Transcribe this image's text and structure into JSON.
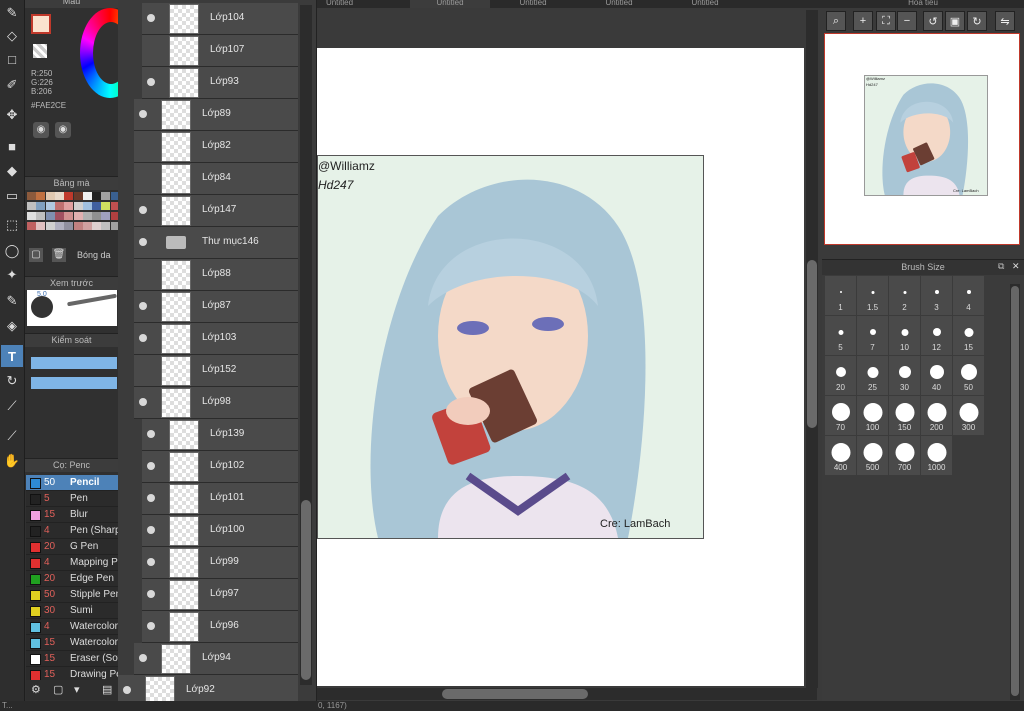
{
  "tabs": [
    "Untitled",
    "Untitled",
    "Untitled",
    "Untitled",
    "Untitled"
  ],
  "color_panel": {
    "title": "Màu",
    "rgb": [
      "R:250",
      "G:226",
      "B:206"
    ],
    "hex": "#FAE2CE",
    "current_color": "#FAE2CE"
  },
  "palette": {
    "title": "Bảng mà",
    "colors": [
      "#8c5a3c",
      "#c07040",
      "#e0c8b0",
      "#e8d8c8",
      "#c0392b",
      "#6b3a2a",
      "#f0f0f0",
      "#202020",
      "#a0a0a0",
      "#3a6090",
      "#c0c0c0",
      "#80a0c0",
      "#b0c8e0",
      "#c07070",
      "#e0a0a0",
      "#d0d0d0",
      "#a0c0e0",
      "#4060a0",
      "#d0e060",
      "#c05050",
      "#e0e0e0",
      "#c0c0c0",
      "#8090b0",
      "#a05060",
      "#d09090",
      "#e0b0b0",
      "#b0b0b0",
      "#909090",
      "#a0a0c0",
      "#b04040",
      "#c06060",
      "#e0c0c0",
      "#d0d0d0",
      "#b0b0c0",
      "#9090a0",
      "#c08080",
      "#d0a0a0",
      "#e0d0d0",
      "#c0c0c0",
      "#a0a0a0"
    ],
    "shadow_label": "Bóng da"
  },
  "preview": {
    "title": "Xem trước",
    "size_label": "5.0"
  },
  "control": {
    "title": "Kiểm soát"
  },
  "brushes": {
    "title": "Cọ: Penc",
    "items": [
      {
        "size": "50",
        "name": "Pencil",
        "color": "#2e8bd6",
        "selected": true
      },
      {
        "size": "5",
        "name": "Pen",
        "color": "#222222",
        "selected": false
      },
      {
        "size": "15",
        "name": "Blur",
        "color": "#f0a0e0",
        "selected": false
      },
      {
        "size": "4",
        "name": "Pen (Sharp)",
        "color": "#222222",
        "selected": false
      },
      {
        "size": "20",
        "name": "G Pen",
        "color": "#e03030",
        "selected": false
      },
      {
        "size": "4",
        "name": "Mapping Pen",
        "color": "#e03030",
        "selected": false
      },
      {
        "size": "20",
        "name": "Edge Pen",
        "color": "#20a020",
        "selected": false
      },
      {
        "size": "50",
        "name": "Stipple Pen",
        "color": "#e0d020",
        "selected": false
      },
      {
        "size": "30",
        "name": "Sumi",
        "color": "#e0d020",
        "selected": false
      },
      {
        "size": "4",
        "name": "Watercolor",
        "color": "#60c0e0",
        "selected": false
      },
      {
        "size": "15",
        "name": "Watercolor",
        "color": "#60c0e0",
        "selected": false
      },
      {
        "size": "15",
        "name": "Eraser (Soft)",
        "color": "#ffffff",
        "selected": false
      },
      {
        "size": "15",
        "name": "Drawing Pen",
        "color": "#e03030",
        "selected": false
      }
    ]
  },
  "layers": [
    {
      "name": "Lớp104",
      "visible": true,
      "folder": false,
      "indent": 1
    },
    {
      "name": "Lớp107",
      "visible": false,
      "folder": false,
      "indent": 1
    },
    {
      "name": "Lớp93",
      "visible": true,
      "folder": false,
      "indent": 1
    },
    {
      "name": "Lớp89",
      "visible": true,
      "folder": false,
      "indent": 0
    },
    {
      "name": "Lớp82",
      "visible": false,
      "folder": false,
      "indent": 0
    },
    {
      "name": "Lớp84",
      "visible": false,
      "folder": false,
      "indent": 0
    },
    {
      "name": "Lớp147",
      "visible": true,
      "folder": false,
      "indent": 0
    },
    {
      "name": "Thư mục146",
      "visible": true,
      "folder": true,
      "indent": 0
    },
    {
      "name": "Lớp88",
      "visible": false,
      "folder": false,
      "indent": 0
    },
    {
      "name": "Lớp87",
      "visible": true,
      "folder": false,
      "indent": 0
    },
    {
      "name": "Lớp103",
      "visible": true,
      "folder": false,
      "indent": 0
    },
    {
      "name": "Lớp152",
      "visible": false,
      "folder": false,
      "indent": 0
    },
    {
      "name": "Lớp98",
      "visible": true,
      "folder": false,
      "indent": 0
    },
    {
      "name": "Lớp139",
      "visible": true,
      "folder": false,
      "indent": 1
    },
    {
      "name": "Lớp102",
      "visible": true,
      "folder": false,
      "indent": 1
    },
    {
      "name": "Lớp101",
      "visible": true,
      "folder": false,
      "indent": 1
    },
    {
      "name": "Lớp100",
      "visible": true,
      "folder": false,
      "indent": 1
    },
    {
      "name": "Lớp99",
      "visible": true,
      "folder": false,
      "indent": 1
    },
    {
      "name": "Lớp97",
      "visible": true,
      "folder": false,
      "indent": 1
    },
    {
      "name": "Lớp96",
      "visible": true,
      "folder": false,
      "indent": 1
    },
    {
      "name": "Lớp94",
      "visible": true,
      "folder": false,
      "indent": 0
    },
    {
      "name": "Lớp92",
      "visible": true,
      "folder": false,
      "indent": -1
    }
  ],
  "artwork": {
    "watermark_line1": "@Williamz",
    "watermark_line2": "Hd247",
    "credit": "Cre: LamBach"
  },
  "navigator": {
    "title": "Hoa tiêu"
  },
  "brush_size": {
    "title": "Brush Size",
    "sizes": [
      "1",
      "1.5",
      "2",
      "3",
      "4",
      "5",
      "7",
      "10",
      "12",
      "15",
      "20",
      "25",
      "30",
      "40",
      "50",
      "70",
      "100",
      "150",
      "200",
      "300",
      "400",
      "500",
      "700",
      "1000"
    ]
  },
  "status": {
    "left": "T...",
    "coords": "0, 1167)"
  }
}
